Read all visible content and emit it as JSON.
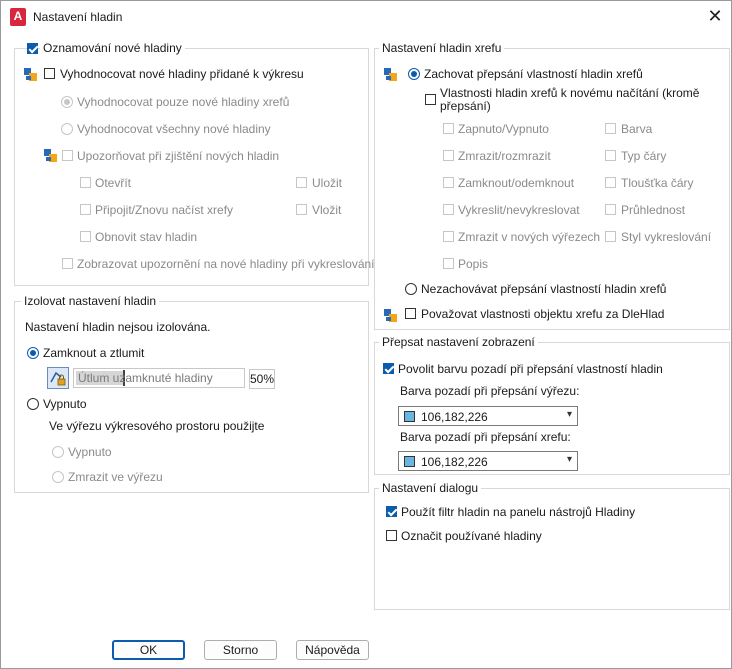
{
  "window": {
    "title": "Nastavení hladin",
    "close_glyph": "✕",
    "app_icon_letter": "A"
  },
  "notify": {
    "title": "Oznamování nové hladiny",
    "evaluate": "Vyhodnocovat nové hladiny přidané k výkresu",
    "eval_xref_only": "Vyhodnocovat pouze nové hladiny xrefů",
    "eval_all": "Vyhodnocovat všechny nové hladiny",
    "notify_when": "Upozorňovat při zjištění nových hladin",
    "open": "Otevřít",
    "save": "Uložit",
    "attach": "Připojit/Znovu načíst xrefy",
    "insert": "Vložit",
    "restore": "Obnovit stav hladin",
    "show_on_plot": "Zobrazovat upozornění na nové hladiny při vykreslování"
  },
  "isolate": {
    "title": "Izolovat nastavení hladin",
    "status": "Nastavení hladin nejsou izolována.",
    "lock_fade": "Zamknout a ztlumit",
    "fade_placeholder": "Útlum uzamknuté hladiny",
    "fade_value": "50%",
    "fade_fraction": 0.5,
    "off": "Vypnuto",
    "viewport_text": "Ve výřezu výkresového prostoru použijte",
    "vp_off": "Vypnuto",
    "vp_freeze": "Zmrazit ve výřezu"
  },
  "xref": {
    "title": "Nastavení hladin xrefu",
    "keep": "Zachovat přepsání vlastností hladin xrefů",
    "reload_line1": "Vlastnosti hladin xrefů k novému načítání (kromě",
    "reload_line2": "přepsání)",
    "props": {
      "on_off": "Zapnuto/Vypnuto",
      "color": "Barva",
      "freeze": "Zmrazit/rozmrazit",
      "linetype": "Typ čáry",
      "lock": "Zamknout/odemknout",
      "lineweight": "Tloušťka čáry",
      "plot": "Vykreslit/nevykreslovat",
      "transparency": "Průhlednost",
      "freeze_new_vp": "Zmrazit v nových výřezech",
      "plotstyle": "Styl vykreslování",
      "description": "Popis"
    },
    "dont_keep": "Nezachovávat přepsání vlastností hladin xrefů",
    "bylayer": "Považovat vlastnosti objektu xrefu za DleHlad"
  },
  "override": {
    "title": "Přepsat nastavení zobrazení",
    "enable_bg": "Povolit barvu pozadí při přepsání vlastností hladin",
    "vp_bg_label": "Barva pozadí při přepsání výřezu:",
    "vp_bg_value": "106,182,226",
    "xref_bg_label": "Barva pozadí při přepsání xrefu:",
    "xref_bg_value": "106,182,226",
    "swatch_color": "#6ab6e2"
  },
  "dialog": {
    "title": "Nastavení dialogu",
    "use_filter": "Použít filtr hladin na panelu nástrojů Hladiny",
    "mark_used": "Označit používané hladiny"
  },
  "buttons": {
    "ok": "OK",
    "cancel": "Storno",
    "help": "Nápověda"
  }
}
